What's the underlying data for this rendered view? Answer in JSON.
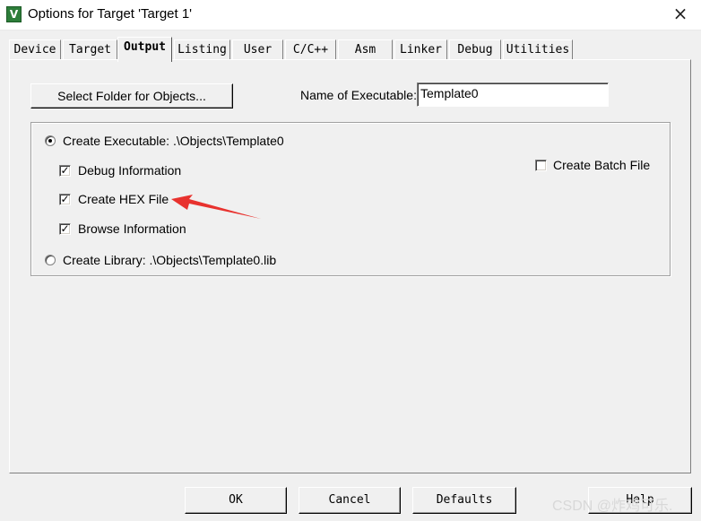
{
  "window": {
    "title": "Options for Target 'Target 1'",
    "icon": "keil-uvision-icon",
    "close_label": "×"
  },
  "tabs": [
    {
      "label": "Device"
    },
    {
      "label": "Target"
    },
    {
      "label": "Output",
      "active": true
    },
    {
      "label": "Listing"
    },
    {
      "label": "User"
    },
    {
      "label": "C/C++"
    },
    {
      "label": "Asm"
    },
    {
      "label": "Linker"
    },
    {
      "label": "Debug"
    },
    {
      "label": "Utilities"
    }
  ],
  "output": {
    "select_folder_label": "Select Folder for Objects...",
    "executable_name_label": "Name of Executable:",
    "executable_name_value": "Template0",
    "create_executable": {
      "label": "Create Executable:  .\\Objects\\Template0",
      "selected": true
    },
    "debug_information": {
      "label": "Debug Information",
      "checked": true
    },
    "create_hex_file": {
      "label": "Create HEX File",
      "checked": true
    },
    "browse_information": {
      "label": "Browse Information",
      "checked": true
    },
    "create_library": {
      "label": "Create Library:  .\\Objects\\Template0.lib",
      "selected": false
    },
    "create_batch_file": {
      "label": "Create Batch File",
      "checked": false
    }
  },
  "annotation": {
    "color": "#e8322e"
  },
  "buttons": {
    "ok": "OK",
    "cancel": "Cancel",
    "defaults": "Defaults",
    "help": "Help"
  },
  "watermark": "CSDN @炸鸡可乐."
}
